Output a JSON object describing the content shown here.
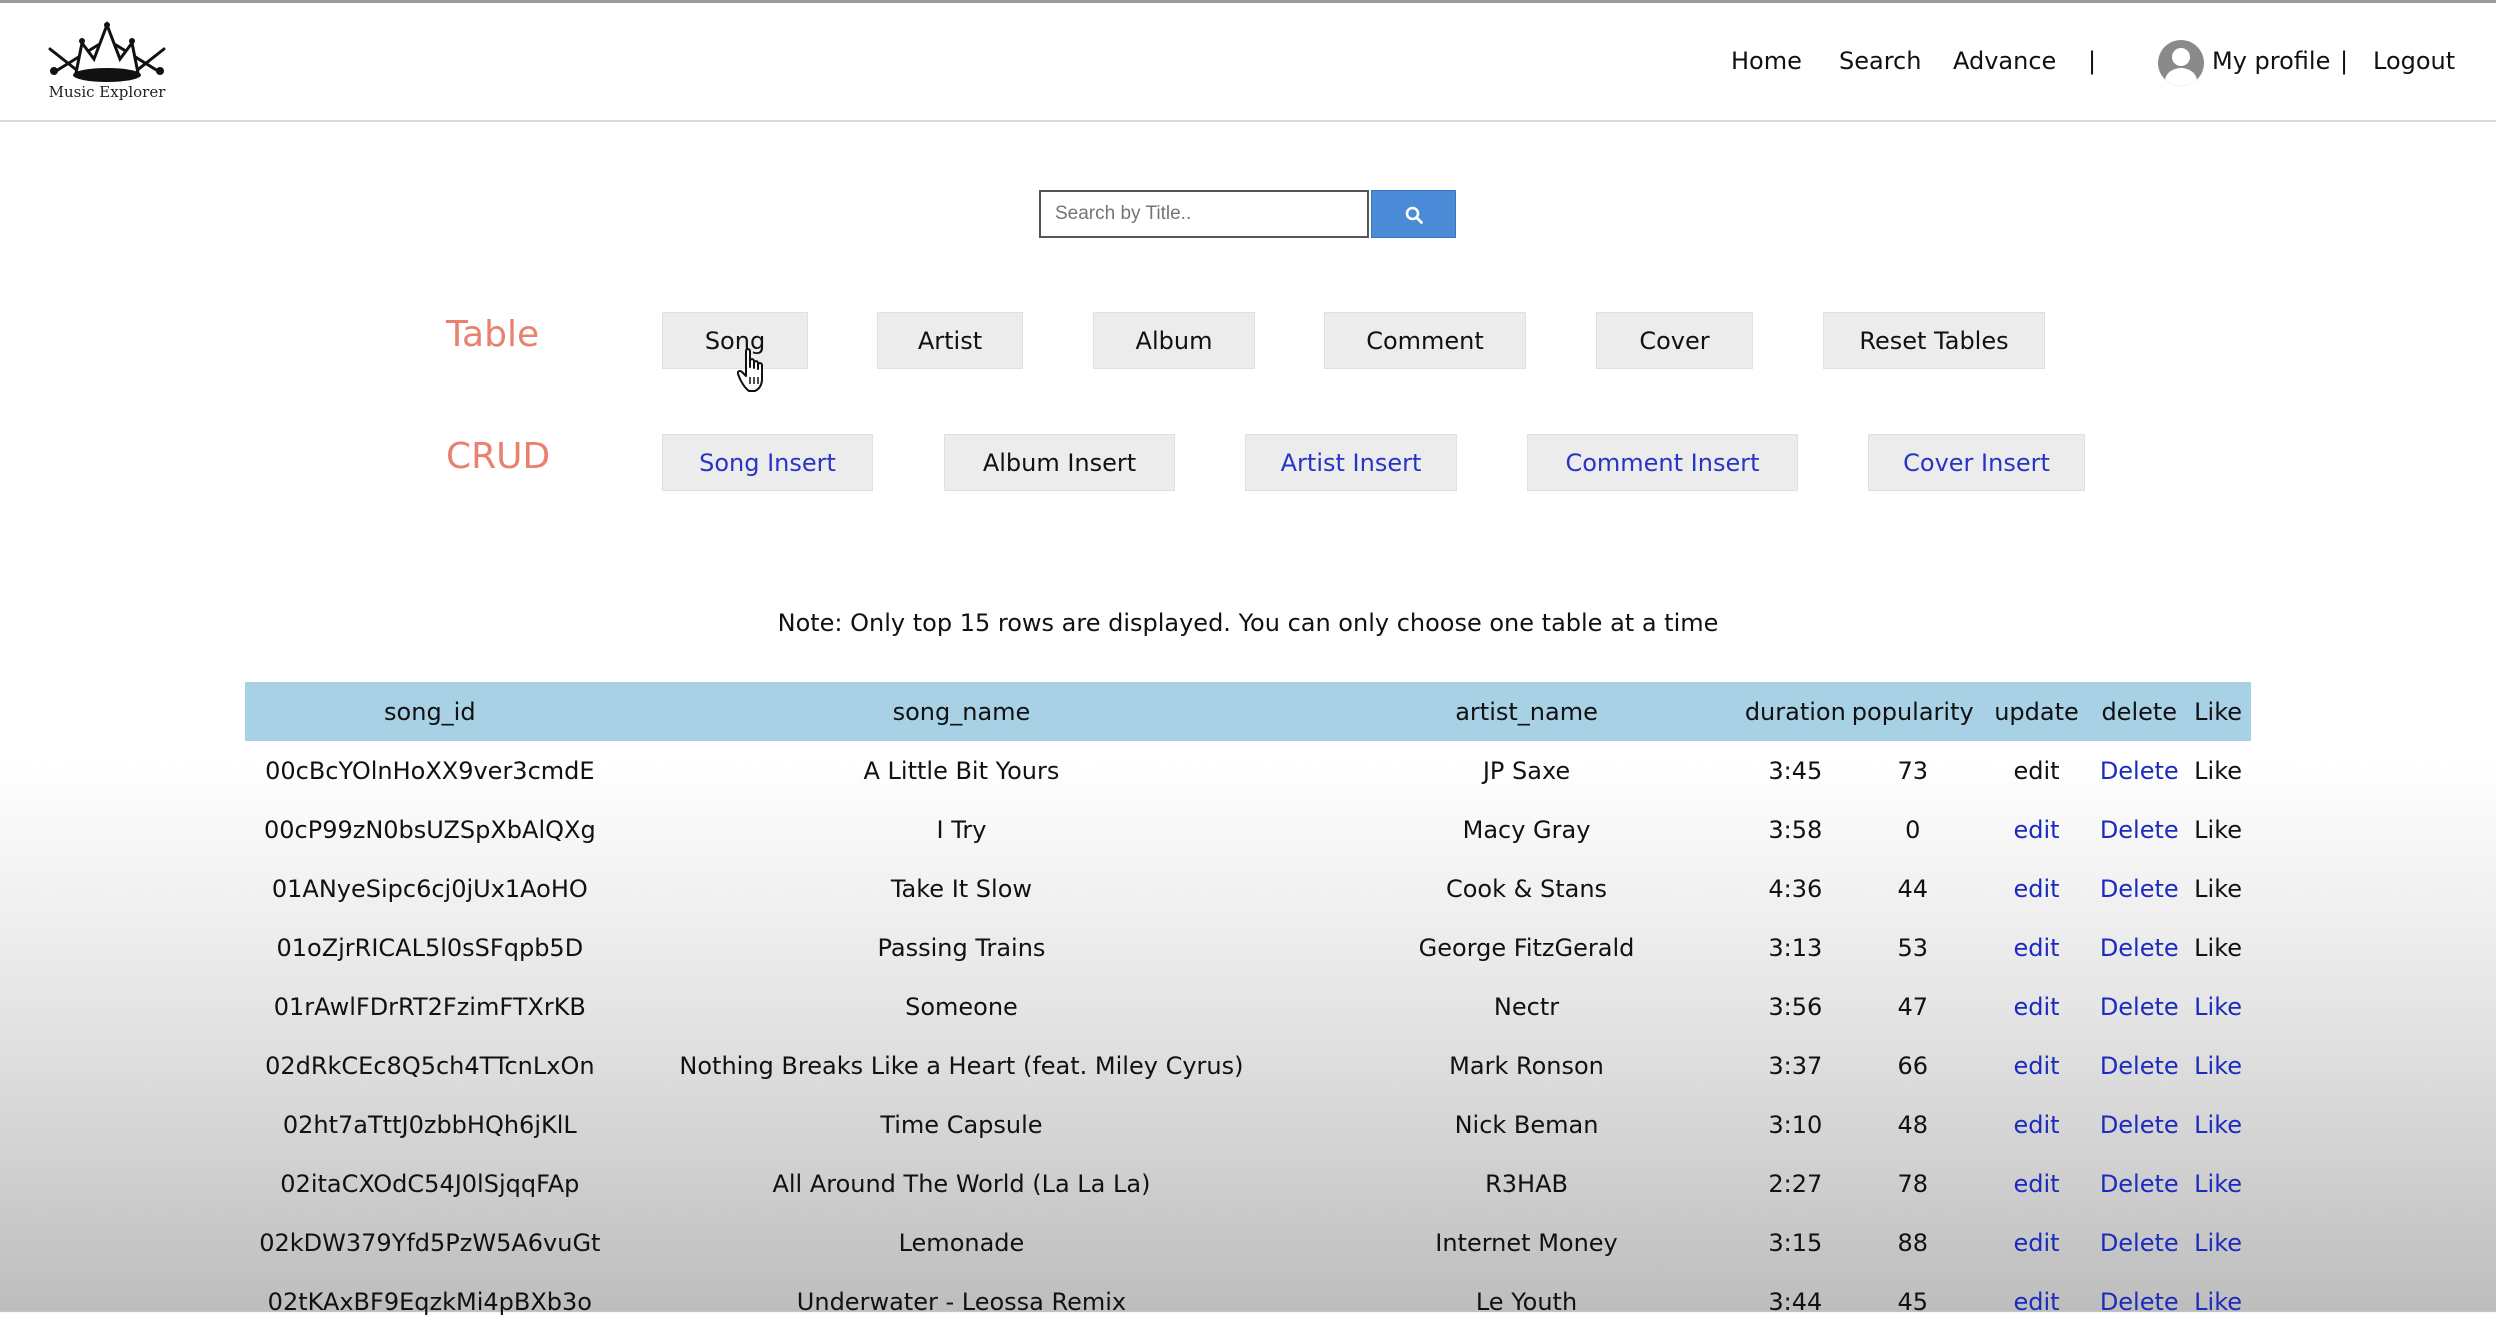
{
  "logo": {
    "text": "Music Explorer"
  },
  "nav": {
    "home": "Home",
    "search": "Search",
    "advance": "Advance",
    "separator": "|",
    "profile": "My profile",
    "separator2": "|",
    "logout": "Logout"
  },
  "search": {
    "placeholder": "Search by Title.."
  },
  "table_section": {
    "label": "Table",
    "buttons": [
      "Song",
      "Artist",
      "Album",
      "Comment",
      "Cover",
      "Reset Tables"
    ]
  },
  "crud_section": {
    "label": "CRUD",
    "buttons": [
      "Song Insert",
      "Album Insert",
      "Artist Insert",
      "Comment Insert",
      "Cover Insert"
    ]
  },
  "note": "Note: Only top 15 rows are displayed. You can only choose one table at a time",
  "songs": {
    "columns": [
      "song_id",
      "song_name",
      "artist_name",
      "duration",
      "popularity",
      "update",
      "delete",
      "Like"
    ],
    "rows": [
      {
        "id": "00cBcYOlnHoXX9ver3cmdE",
        "name": "A Little Bit Yours",
        "artist": "JP Saxe",
        "duration": "3:45",
        "popularity": "73",
        "update": "edit",
        "delete": "Delete",
        "like": "Like"
      },
      {
        "id": "00cP99zN0bsUZSpXbAlQXg",
        "name": "I Try",
        "artist": "Macy Gray",
        "duration": "3:58",
        "popularity": "0",
        "update": "edit",
        "delete": "Delete",
        "like": "Like"
      },
      {
        "id": "01ANyeSipc6cj0jUx1AoHO",
        "name": "Take It Slow",
        "artist": "Cook & Stans",
        "duration": "4:36",
        "popularity": "44",
        "update": "edit",
        "delete": "Delete",
        "like": "Like"
      },
      {
        "id": "01oZjrRICAL5l0sSFqpb5D",
        "name": "Passing Trains",
        "artist": "George FitzGerald",
        "duration": "3:13",
        "popularity": "53",
        "update": "edit",
        "delete": "Delete",
        "like": "Like"
      },
      {
        "id": "01rAwlFDrRT2FzimFTXrKB",
        "name": "Someone",
        "artist": "Nectr",
        "duration": "3:56",
        "popularity": "47",
        "update": "edit",
        "delete": "Delete",
        "like": "Like"
      },
      {
        "id": "02dRkCEc8Q5ch4TTcnLxOn",
        "name": "Nothing Breaks Like a Heart (feat. Miley Cyrus)",
        "artist": "Mark Ronson",
        "duration": "3:37",
        "popularity": "66",
        "update": "edit",
        "delete": "Delete",
        "like": "Like"
      },
      {
        "id": "02ht7aTttJ0zbbHQh6jKlL",
        "name": "Time Capsule",
        "artist": "Nick Beman",
        "duration": "3:10",
        "popularity": "48",
        "update": "edit",
        "delete": "Delete",
        "like": "Like"
      },
      {
        "id": "02itaCXOdC54J0lSjqqFAp",
        "name": "All Around The World (La La La)",
        "artist": "R3HAB",
        "duration": "2:27",
        "popularity": "78",
        "update": "edit",
        "delete": "Delete",
        "like": "Like"
      },
      {
        "id": "02kDW379Yfd5PzW5A6vuGt",
        "name": "Lemonade",
        "artist": "Internet Money",
        "duration": "3:15",
        "popularity": "88",
        "update": "edit",
        "delete": "Delete",
        "like": "Like"
      },
      {
        "id": "02tKAxBF9EqzkMi4pBXb3o",
        "name": "Underwater - Leossa Remix",
        "artist": "Le Youth",
        "duration": "3:44",
        "popularity": "45",
        "update": "edit",
        "delete": "Delete",
        "like": "Like"
      }
    ]
  },
  "colors": {
    "accent_label": "#e8826f",
    "header_bg": "#a8d1e6",
    "link": "#1b2bbd",
    "search_button": "#4a8ad6"
  },
  "icons": {
    "search": "search-icon",
    "cursor": "hand-pointer-icon",
    "avatar": "user-avatar-icon"
  }
}
